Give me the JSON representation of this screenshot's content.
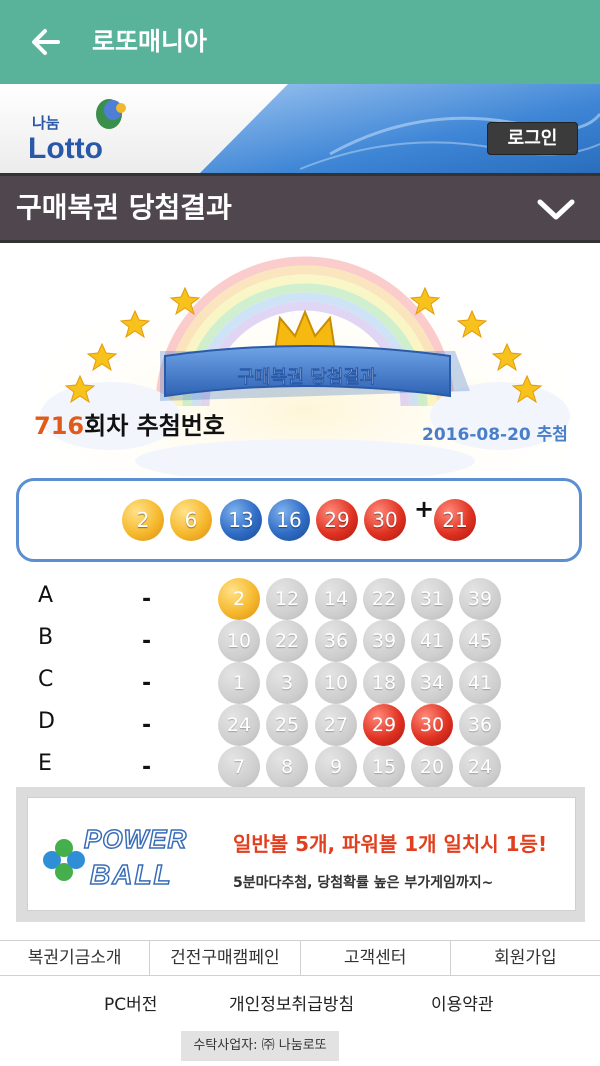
{
  "appbar": {
    "title": "로또매니아",
    "back_icon": "arrow-left-icon"
  },
  "brand": {
    "logo_small": "나눔",
    "logo_main": "Lotto",
    "login_label": "로그인"
  },
  "section": {
    "title": "구매복권 당첨결과",
    "toggle_icon": "chevron-down-icon"
  },
  "banner": {
    "ribbon_text": "구매복권 당첨결과"
  },
  "draw": {
    "round": "716",
    "round_suffix": "회차 추첨번호",
    "date": "2016-08-20 추첨"
  },
  "winning": {
    "numbers": [
      "2",
      "6",
      "13",
      "16",
      "29",
      "30"
    ],
    "plus": "+",
    "bonus": "21"
  },
  "tickets": [
    {
      "label": "A",
      "dash": "-",
      "numbers": [
        "2",
        "12",
        "14",
        "22",
        "31",
        "39"
      ]
    },
    {
      "label": "B",
      "dash": "-",
      "numbers": [
        "10",
        "22",
        "36",
        "39",
        "41",
        "45"
      ]
    },
    {
      "label": "C",
      "dash": "-",
      "numbers": [
        "1",
        "3",
        "10",
        "18",
        "34",
        "41"
      ]
    },
    {
      "label": "D",
      "dash": "-",
      "numbers": [
        "24",
        "25",
        "27",
        "29",
        "30",
        "36"
      ]
    },
    {
      "label": "E",
      "dash": "-",
      "numbers": [
        "7",
        "8",
        "9",
        "15",
        "20",
        "24"
      ]
    }
  ],
  "ad": {
    "logo_top": "POWER",
    "logo_bottom": "BALL",
    "line1": "일반볼 5개, 파워볼 1개 일치시 1등!",
    "line2": "5분마다추첨, 당첨확률 높은 부가게임까지~"
  },
  "footer": {
    "tabs": [
      "복권기금소개",
      "건전구매캠페인",
      "고객센터",
      "회원가입"
    ],
    "links": [
      "PC버전",
      "개인정보취급방침",
      "이용약관"
    ],
    "company": "수탁사업자: ㈜ 나눔로또"
  },
  "colors": {
    "appbar": "#58b39a",
    "section": "#4f464e",
    "accent_blue": "#5b8fd1",
    "round_orange": "#e05a1a"
  }
}
